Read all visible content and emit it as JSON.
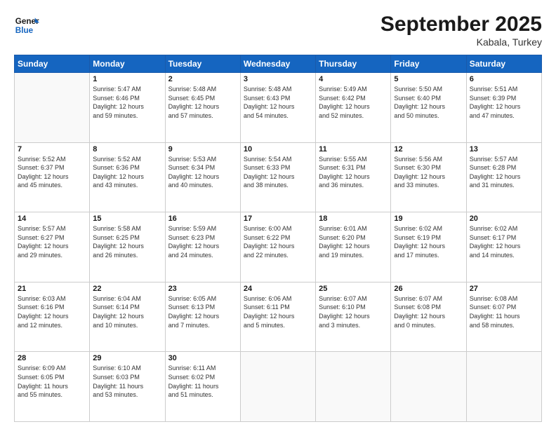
{
  "header": {
    "logo_line1": "General",
    "logo_line2": "Blue",
    "month": "September 2025",
    "location": "Kabala, Turkey"
  },
  "days_of_week": [
    "Sunday",
    "Monday",
    "Tuesday",
    "Wednesday",
    "Thursday",
    "Friday",
    "Saturday"
  ],
  "weeks": [
    [
      {
        "day": "",
        "info": ""
      },
      {
        "day": "1",
        "info": "Sunrise: 5:47 AM\nSunset: 6:46 PM\nDaylight: 12 hours\nand 59 minutes."
      },
      {
        "day": "2",
        "info": "Sunrise: 5:48 AM\nSunset: 6:45 PM\nDaylight: 12 hours\nand 57 minutes."
      },
      {
        "day": "3",
        "info": "Sunrise: 5:48 AM\nSunset: 6:43 PM\nDaylight: 12 hours\nand 54 minutes."
      },
      {
        "day": "4",
        "info": "Sunrise: 5:49 AM\nSunset: 6:42 PM\nDaylight: 12 hours\nand 52 minutes."
      },
      {
        "day": "5",
        "info": "Sunrise: 5:50 AM\nSunset: 6:40 PM\nDaylight: 12 hours\nand 50 minutes."
      },
      {
        "day": "6",
        "info": "Sunrise: 5:51 AM\nSunset: 6:39 PM\nDaylight: 12 hours\nand 47 minutes."
      }
    ],
    [
      {
        "day": "7",
        "info": "Sunrise: 5:52 AM\nSunset: 6:37 PM\nDaylight: 12 hours\nand 45 minutes."
      },
      {
        "day": "8",
        "info": "Sunrise: 5:52 AM\nSunset: 6:36 PM\nDaylight: 12 hours\nand 43 minutes."
      },
      {
        "day": "9",
        "info": "Sunrise: 5:53 AM\nSunset: 6:34 PM\nDaylight: 12 hours\nand 40 minutes."
      },
      {
        "day": "10",
        "info": "Sunrise: 5:54 AM\nSunset: 6:33 PM\nDaylight: 12 hours\nand 38 minutes."
      },
      {
        "day": "11",
        "info": "Sunrise: 5:55 AM\nSunset: 6:31 PM\nDaylight: 12 hours\nand 36 minutes."
      },
      {
        "day": "12",
        "info": "Sunrise: 5:56 AM\nSunset: 6:30 PM\nDaylight: 12 hours\nand 33 minutes."
      },
      {
        "day": "13",
        "info": "Sunrise: 5:57 AM\nSunset: 6:28 PM\nDaylight: 12 hours\nand 31 minutes."
      }
    ],
    [
      {
        "day": "14",
        "info": "Sunrise: 5:57 AM\nSunset: 6:27 PM\nDaylight: 12 hours\nand 29 minutes."
      },
      {
        "day": "15",
        "info": "Sunrise: 5:58 AM\nSunset: 6:25 PM\nDaylight: 12 hours\nand 26 minutes."
      },
      {
        "day": "16",
        "info": "Sunrise: 5:59 AM\nSunset: 6:23 PM\nDaylight: 12 hours\nand 24 minutes."
      },
      {
        "day": "17",
        "info": "Sunrise: 6:00 AM\nSunset: 6:22 PM\nDaylight: 12 hours\nand 22 minutes."
      },
      {
        "day": "18",
        "info": "Sunrise: 6:01 AM\nSunset: 6:20 PM\nDaylight: 12 hours\nand 19 minutes."
      },
      {
        "day": "19",
        "info": "Sunrise: 6:02 AM\nSunset: 6:19 PM\nDaylight: 12 hours\nand 17 minutes."
      },
      {
        "day": "20",
        "info": "Sunrise: 6:02 AM\nSunset: 6:17 PM\nDaylight: 12 hours\nand 14 minutes."
      }
    ],
    [
      {
        "day": "21",
        "info": "Sunrise: 6:03 AM\nSunset: 6:16 PM\nDaylight: 12 hours\nand 12 minutes."
      },
      {
        "day": "22",
        "info": "Sunrise: 6:04 AM\nSunset: 6:14 PM\nDaylight: 12 hours\nand 10 minutes."
      },
      {
        "day": "23",
        "info": "Sunrise: 6:05 AM\nSunset: 6:13 PM\nDaylight: 12 hours\nand 7 minutes."
      },
      {
        "day": "24",
        "info": "Sunrise: 6:06 AM\nSunset: 6:11 PM\nDaylight: 12 hours\nand 5 minutes."
      },
      {
        "day": "25",
        "info": "Sunrise: 6:07 AM\nSunset: 6:10 PM\nDaylight: 12 hours\nand 3 minutes."
      },
      {
        "day": "26",
        "info": "Sunrise: 6:07 AM\nSunset: 6:08 PM\nDaylight: 12 hours\nand 0 minutes."
      },
      {
        "day": "27",
        "info": "Sunrise: 6:08 AM\nSunset: 6:07 PM\nDaylight: 11 hours\nand 58 minutes."
      }
    ],
    [
      {
        "day": "28",
        "info": "Sunrise: 6:09 AM\nSunset: 6:05 PM\nDaylight: 11 hours\nand 55 minutes."
      },
      {
        "day": "29",
        "info": "Sunrise: 6:10 AM\nSunset: 6:03 PM\nDaylight: 11 hours\nand 53 minutes."
      },
      {
        "day": "30",
        "info": "Sunrise: 6:11 AM\nSunset: 6:02 PM\nDaylight: 11 hours\nand 51 minutes."
      },
      {
        "day": "",
        "info": ""
      },
      {
        "day": "",
        "info": ""
      },
      {
        "day": "",
        "info": ""
      },
      {
        "day": "",
        "info": ""
      }
    ]
  ]
}
